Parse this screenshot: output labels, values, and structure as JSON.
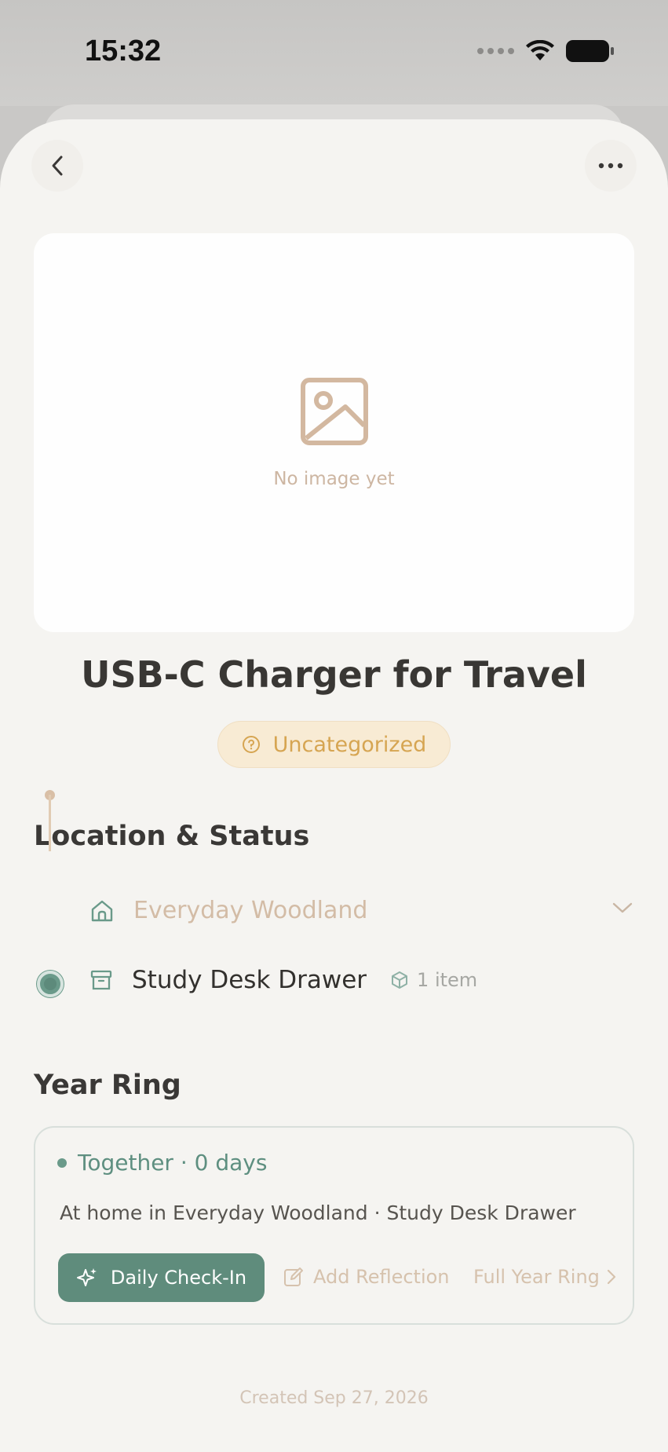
{
  "status_bar": {
    "time": "15:32"
  },
  "header": {
    "back_icon": "chevron-left-icon",
    "more_icon": "ellipsis-icon"
  },
  "image": {
    "placeholder_text": "No image yet",
    "icon": "image-placeholder-icon"
  },
  "item": {
    "title": "USB-C Charger for Travel",
    "category": "Uncategorized"
  },
  "location_section": {
    "title": "Location & Status",
    "parent": {
      "label": "Everyday Woodland",
      "icon": "house-icon"
    },
    "current": {
      "label": "Study Desk Drawer",
      "icon": "archive-box-icon",
      "count_label": "1 item"
    }
  },
  "year_ring": {
    "title": "Year Ring",
    "together_label": "Together · 0 days",
    "at_home_text": "At home in Everyday Woodland · Study Desk Drawer",
    "checkin_label": "Daily Check-In",
    "reflection_label": "Add Reflection",
    "full_ring_label": "Full Year Ring"
  },
  "footer": {
    "created_text": "Created Sep 27, 2026"
  },
  "colors": {
    "accent_green": "#5f8c7c",
    "chip_amber": "#d6a552",
    "muted_tan": "#d3bca6",
    "sheet_bg": "#f5f4f1"
  }
}
